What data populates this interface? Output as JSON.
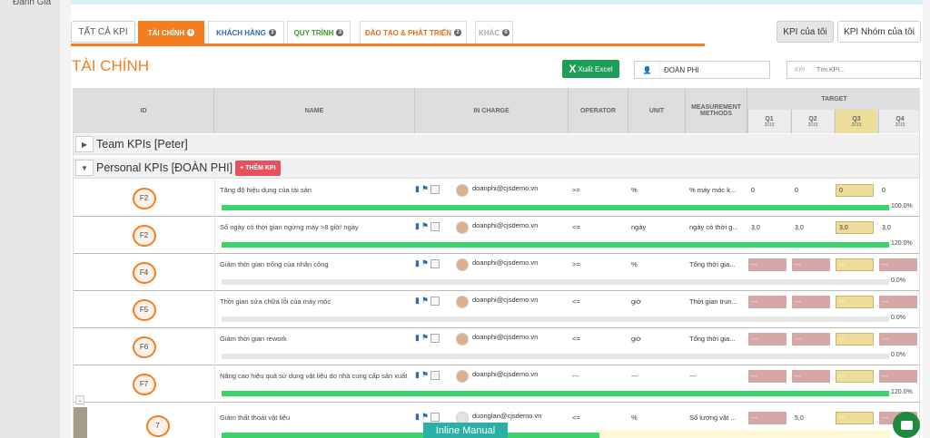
{
  "nav": {
    "label": "Đánh Giá"
  },
  "tabs": [
    {
      "label": "TẤT CẢ KPI",
      "count": ""
    },
    {
      "label": "TÀI CHÍNH",
      "count": "6"
    },
    {
      "label": "KHÁCH HÀNG",
      "count": "3"
    },
    {
      "label": "QUY TRÌNH",
      "count": "3"
    },
    {
      "label": "ĐÀO TẠO & PHÁT TRIỂN",
      "count": "2"
    },
    {
      "label": "KHÁC",
      "count": "0"
    }
  ],
  "tab_colors": [
    "#555555",
    "#ffffff",
    "#2a6db3",
    "#3a9a2b",
    "#e06c1a",
    "#aaaaaa"
  ],
  "kpi_buttons": {
    "mine": "KPI của tôi",
    "group": "KPI Nhóm của tôi"
  },
  "page_title": "TÀI CHÍNH",
  "excel_button": "Xuất Excel",
  "user_filter": {
    "value": "ĐOÀN PHI"
  },
  "search": {
    "icon_text": "KPI",
    "placeholder": "Tìm KPI..."
  },
  "table_headers": {
    "id": "ID",
    "name": "NAME",
    "in_charge": "IN CHARGE",
    "operator": "OPERATOR",
    "unit": "UNIT",
    "measurement": "MEASUREMENT METHODS",
    "target": "TARGET",
    "quarters": [
      {
        "q": "Q1",
        "year": "2015"
      },
      {
        "q": "Q2",
        "year": "2015"
      },
      {
        "q": "Q3",
        "year": "2015"
      },
      {
        "q": "Q4",
        "year": "2015"
      }
    ]
  },
  "groups": [
    {
      "label": "Team KPIs [Peter]",
      "toggle": "▶"
    },
    {
      "label": "Personal KPIs [ĐOÀN PHI]",
      "toggle": "▼",
      "add_label": "+ THÊM KPI"
    }
  ],
  "rows": [
    {
      "id": "F2",
      "name": "Tăng độ hiệu dụng của tài sản",
      "email": "doanphi@cjsdemo.vn",
      "operator": ">=",
      "unit": "%",
      "method": "% máy móc k...",
      "targets": [
        "0",
        "0",
        "0",
        "0"
      ],
      "progress_pct": 100,
      "progress_label": "100.0%",
      "red": false
    },
    {
      "id": "F2",
      "name": "Số ngày có thời gian ngừng máy >8 giờ/ ngày",
      "email": "doanphi@cjsdemo.vn",
      "operator": "<=",
      "unit": "ngày",
      "method": "ngày có thời g...",
      "targets": [
        "3,0",
        "3,0",
        "3,0",
        "3,0"
      ],
      "progress_pct": 100,
      "progress_label": "120.0%",
      "red": false
    },
    {
      "id": "F4",
      "name": "Giảm thời gian trống của nhân công",
      "email": "doanphi@cjsdemo.vn",
      "operator": ">=",
      "unit": "%",
      "method": "Tổng thời gia...",
      "targets": [
        "---",
        "---",
        "---",
        "---"
      ],
      "progress_pct": 0,
      "progress_label": "0.0%",
      "red": true
    },
    {
      "id": "F5",
      "name": "Thời gian sửa chữa lỗi của máy móc",
      "email": "doanphi@cjsdemo.vn",
      "operator": "<=",
      "unit": "giờ",
      "method": "Thời gian trun...",
      "targets": [
        "---",
        "---",
        "---",
        "---"
      ],
      "progress_pct": 0,
      "progress_label": "0.0%",
      "red": true
    },
    {
      "id": "F6",
      "name": "Giảm thời gian rework",
      "email": "doanphi@cjsdemo.vn",
      "operator": "<=",
      "unit": "giờ",
      "method": "Tổng thời gia...",
      "targets": [
        "---",
        "---",
        "---",
        "---"
      ],
      "progress_pct": 0,
      "progress_label": "0.0%",
      "red": true
    },
    {
      "id": "F7",
      "name": "Nâng cao hiệu quả sử dụng vật liệu do nhà cung cấp sản xuất",
      "email": "doanphi@cjsdemo.vn",
      "operator": "---",
      "unit": "---",
      "method": "---",
      "targets": [
        "---",
        "---",
        "---",
        "---"
      ],
      "progress_pct": 100,
      "progress_label": "120.0%",
      "red": true
    },
    {
      "id": "7",
      "name": "Giảm thất thoát vật liệu",
      "email": "duonglan@cjsdemo.vn",
      "operator": "<=",
      "unit": "%",
      "method": "Số lượng vật ...",
      "targets": [
        "---",
        "5,0",
        "---",
        "---"
      ],
      "progress_pct": 100,
      "progress_label": "",
      "red": true,
      "sub": true
    }
  ],
  "inline_manual": "Inline Manual"
}
